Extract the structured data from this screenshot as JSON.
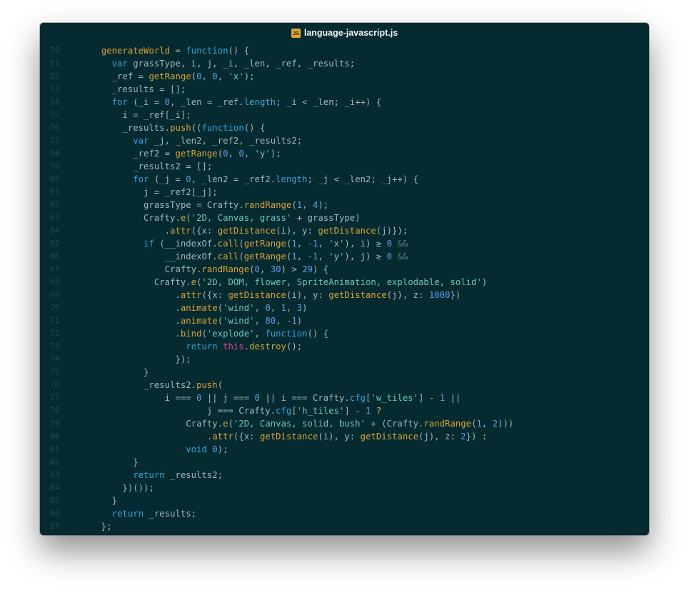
{
  "window": {
    "title": "language-javascript.js",
    "file_icon_label": "JS"
  },
  "editor": {
    "lines": [
      {
        "n": "50",
        "tokens": [
          [
            "pl",
            "  "
          ],
          [
            "def",
            "generateWorld"
          ],
          [
            "pl",
            " = "
          ],
          [
            "kw",
            "function"
          ],
          [
            "pl",
            "() {"
          ]
        ]
      },
      {
        "n": "51",
        "tokens": [
          [
            "pl",
            "    "
          ],
          [
            "kw",
            "var"
          ],
          [
            "pl",
            " grassType, i, j, _i, _len, _ref, _results;"
          ]
        ]
      },
      {
        "n": "52",
        "tokens": [
          [
            "pl",
            "    _ref = "
          ],
          [
            "fn",
            "getRange"
          ],
          [
            "pl",
            "("
          ],
          [
            "num",
            "0"
          ],
          [
            "pl",
            ", "
          ],
          [
            "num",
            "0"
          ],
          [
            "pl",
            ", "
          ],
          [
            "str",
            "'x'"
          ],
          [
            "pl",
            ");"
          ]
        ]
      },
      {
        "n": "53",
        "tokens": [
          [
            "pl",
            "    _results = [];"
          ]
        ]
      },
      {
        "n": "54",
        "tokens": [
          [
            "pl",
            "    "
          ],
          [
            "kw",
            "for"
          ],
          [
            "pl",
            " (_i = "
          ],
          [
            "num",
            "0"
          ],
          [
            "pl",
            ", _len = _ref."
          ],
          [
            "prop",
            "length"
          ],
          [
            "pl",
            "; _i < _len; _i++) {"
          ]
        ]
      },
      {
        "n": "55",
        "tokens": [
          [
            "pl",
            "      i = _ref[_i];"
          ]
        ]
      },
      {
        "n": "56",
        "tokens": [
          [
            "pl",
            "      _results."
          ],
          [
            "fn",
            "push"
          ],
          [
            "pl",
            "(("
          ],
          [
            "kw",
            "function"
          ],
          [
            "pl",
            "() {"
          ]
        ]
      },
      {
        "n": "57",
        "tokens": [
          [
            "pl",
            "        "
          ],
          [
            "kw",
            "var"
          ],
          [
            "pl",
            " _j, _len2, _ref2, _results2;"
          ]
        ]
      },
      {
        "n": "58",
        "tokens": [
          [
            "pl",
            "        _ref2 = "
          ],
          [
            "fn",
            "getRange"
          ],
          [
            "pl",
            "("
          ],
          [
            "num",
            "0"
          ],
          [
            "pl",
            ", "
          ],
          [
            "num",
            "0"
          ],
          [
            "pl",
            ", "
          ],
          [
            "str",
            "'y'"
          ],
          [
            "pl",
            ");"
          ]
        ]
      },
      {
        "n": "59",
        "tokens": [
          [
            "pl",
            "        _results2 = [];"
          ]
        ]
      },
      {
        "n": "60",
        "tokens": [
          [
            "pl",
            "        "
          ],
          [
            "kw",
            "for"
          ],
          [
            "pl",
            " (_j = "
          ],
          [
            "num",
            "0"
          ],
          [
            "pl",
            ", _len2 = _ref2."
          ],
          [
            "prop",
            "length"
          ],
          [
            "pl",
            "; _j < _len2; _j++) {"
          ]
        ]
      },
      {
        "n": "61",
        "tokens": [
          [
            "pl",
            "          j = _ref2[_j];"
          ]
        ]
      },
      {
        "n": "62",
        "tokens": [
          [
            "pl",
            "          grassType = Crafty."
          ],
          [
            "fn",
            "randRange"
          ],
          [
            "pl",
            "("
          ],
          [
            "num",
            "1"
          ],
          [
            "pl",
            ", "
          ],
          [
            "num",
            "4"
          ],
          [
            "pl",
            ");"
          ]
        ]
      },
      {
        "n": "63",
        "tokens": [
          [
            "pl",
            "          Crafty."
          ],
          [
            "fn",
            "e"
          ],
          [
            "pl",
            "("
          ],
          [
            "str",
            "'2D, Canvas, grass'"
          ],
          [
            "pl",
            " + grassType)"
          ]
        ]
      },
      {
        "n": "64",
        "tokens": [
          [
            "pl",
            "              ."
          ],
          [
            "fn",
            "attr"
          ],
          [
            "pl",
            "({x: "
          ],
          [
            "fn",
            "getDistance"
          ],
          [
            "pl",
            "(i), y: "
          ],
          [
            "fn",
            "getDistance"
          ],
          [
            "pl",
            "(j)});"
          ]
        ]
      },
      {
        "n": "65",
        "tokens": [
          [
            "pl",
            "          "
          ],
          [
            "kw",
            "if"
          ],
          [
            "pl",
            " (__indexOf."
          ],
          [
            "fn",
            "call"
          ],
          [
            "pl",
            "("
          ],
          [
            "fn",
            "getRange"
          ],
          [
            "pl",
            "("
          ],
          [
            "num",
            "1"
          ],
          [
            "pl",
            ", "
          ],
          [
            "num",
            "-1"
          ],
          [
            "pl",
            ", "
          ],
          [
            "str",
            "'x'"
          ],
          [
            "pl",
            "), i) ≥ "
          ],
          [
            "num",
            "0"
          ],
          [
            "pl",
            " "
          ],
          [
            "dim",
            "&&"
          ]
        ]
      },
      {
        "n": "66",
        "tokens": [
          [
            "pl",
            "              __indexOf."
          ],
          [
            "fn",
            "call"
          ],
          [
            "pl",
            "("
          ],
          [
            "fn",
            "getRange"
          ],
          [
            "pl",
            "("
          ],
          [
            "num",
            "1"
          ],
          [
            "pl",
            ", "
          ],
          [
            "num",
            "-1"
          ],
          [
            "pl",
            ", "
          ],
          [
            "str",
            "'y'"
          ],
          [
            "pl",
            "), j) ≥ "
          ],
          [
            "num",
            "0"
          ],
          [
            "pl",
            " "
          ],
          [
            "dim",
            "&&"
          ]
        ]
      },
      {
        "n": "67",
        "tokens": [
          [
            "pl",
            "              Crafty."
          ],
          [
            "fn",
            "randRange"
          ],
          [
            "pl",
            "("
          ],
          [
            "num",
            "0"
          ],
          [
            "pl",
            ", "
          ],
          [
            "num",
            "30"
          ],
          [
            "pl",
            ") > "
          ],
          [
            "num",
            "29"
          ],
          [
            "pl",
            ") {"
          ]
        ]
      },
      {
        "n": "68",
        "tokens": [
          [
            "pl",
            "            Crafty."
          ],
          [
            "fn",
            "e"
          ],
          [
            "pl",
            "("
          ],
          [
            "str",
            "'2D, DOM, flower, SpriteAnimation, explodable, solid'"
          ],
          [
            "pl",
            ")"
          ]
        ]
      },
      {
        "n": "69",
        "tokens": [
          [
            "pl",
            "                ."
          ],
          [
            "fn",
            "attr"
          ],
          [
            "pl",
            "({x: "
          ],
          [
            "fn",
            "getDistance"
          ],
          [
            "pl",
            "(i), y: "
          ],
          [
            "fn",
            "getDistance"
          ],
          [
            "pl",
            "(j), z: "
          ],
          [
            "num",
            "1000"
          ],
          [
            "pl",
            "})"
          ]
        ]
      },
      {
        "n": "70",
        "tokens": [
          [
            "pl",
            "                ."
          ],
          [
            "fn",
            "animate"
          ],
          [
            "pl",
            "("
          ],
          [
            "str",
            "'wind'"
          ],
          [
            "pl",
            ", "
          ],
          [
            "num",
            "0"
          ],
          [
            "pl",
            ", "
          ],
          [
            "num",
            "1"
          ],
          [
            "pl",
            ", "
          ],
          [
            "num",
            "3"
          ],
          [
            "pl",
            ")"
          ]
        ]
      },
      {
        "n": "71",
        "tokens": [
          [
            "pl",
            "                ."
          ],
          [
            "fn",
            "animate"
          ],
          [
            "pl",
            "("
          ],
          [
            "str",
            "'wind'"
          ],
          [
            "pl",
            ", "
          ],
          [
            "num",
            "80"
          ],
          [
            "pl",
            ", "
          ],
          [
            "num",
            "-1"
          ],
          [
            "pl",
            ")"
          ]
        ]
      },
      {
        "n": "72",
        "tokens": [
          [
            "pl",
            "                ."
          ],
          [
            "fn",
            "bind"
          ],
          [
            "pl",
            "("
          ],
          [
            "str",
            "'explode'"
          ],
          [
            "pl",
            ", "
          ],
          [
            "kw",
            "function"
          ],
          [
            "pl",
            "() {"
          ]
        ]
      },
      {
        "n": "73",
        "tokens": [
          [
            "pl",
            "                  "
          ],
          [
            "kw",
            "return"
          ],
          [
            "pl",
            " "
          ],
          [
            "this",
            "this"
          ],
          [
            "pl",
            "."
          ],
          [
            "fn",
            "destroy"
          ],
          [
            "pl",
            "();"
          ]
        ]
      },
      {
        "n": "74",
        "tokens": [
          [
            "pl",
            "                });"
          ]
        ]
      },
      {
        "n": "75",
        "tokens": [
          [
            "pl",
            "          }"
          ]
        ]
      },
      {
        "n": "76",
        "tokens": [
          [
            "pl",
            "          _results2."
          ],
          [
            "fn",
            "push"
          ],
          [
            "pl",
            "("
          ]
        ]
      },
      {
        "n": "77",
        "tokens": [
          [
            "pl",
            "              i === "
          ],
          [
            "num",
            "0"
          ],
          [
            "pl",
            " || j === "
          ],
          [
            "num",
            "0"
          ],
          [
            "pl",
            " || i === Crafty."
          ],
          [
            "prop",
            "cfg"
          ],
          [
            "pl",
            "["
          ],
          [
            "str",
            "'w_tiles'"
          ],
          [
            "pl",
            "] - "
          ],
          [
            "num",
            "1"
          ],
          [
            "pl",
            " ||"
          ]
        ]
      },
      {
        "n": "78",
        "tokens": [
          [
            "pl",
            "                      j === Crafty."
          ],
          [
            "prop",
            "cfg"
          ],
          [
            "pl",
            "["
          ],
          [
            "str",
            "'h_tiles'"
          ],
          [
            "pl",
            "] - "
          ],
          [
            "num",
            "1"
          ],
          [
            "pl",
            " "
          ],
          [
            "yel",
            "?"
          ]
        ]
      },
      {
        "n": "79",
        "tokens": [
          [
            "pl",
            "                  Crafty."
          ],
          [
            "fn",
            "e"
          ],
          [
            "pl",
            "("
          ],
          [
            "str",
            "'2D, Canvas, solid, bush'"
          ],
          [
            "pl",
            " + (Crafty."
          ],
          [
            "fn",
            "randRange"
          ],
          [
            "pl",
            "("
          ],
          [
            "num",
            "1"
          ],
          [
            "pl",
            ", "
          ],
          [
            "num",
            "2"
          ],
          [
            "pl",
            ")))"
          ]
        ]
      },
      {
        "n": "80",
        "tokens": [
          [
            "pl",
            "                      ."
          ],
          [
            "fn",
            "attr"
          ],
          [
            "pl",
            "({x: "
          ],
          [
            "fn",
            "getDistance"
          ],
          [
            "pl",
            "(i), y: "
          ],
          [
            "fn",
            "getDistance"
          ],
          [
            "pl",
            "(j), z: "
          ],
          [
            "num",
            "2"
          ],
          [
            "pl",
            "}) "
          ],
          [
            "yel",
            ":"
          ]
        ]
      },
      {
        "n": "81",
        "tokens": [
          [
            "pl",
            "                  "
          ],
          [
            "kw",
            "void"
          ],
          [
            "pl",
            " "
          ],
          [
            "num",
            "0"
          ],
          [
            "pl",
            ");"
          ]
        ]
      },
      {
        "n": "82",
        "tokens": [
          [
            "pl",
            "        }"
          ]
        ]
      },
      {
        "n": "83",
        "tokens": [
          [
            "pl",
            "        "
          ],
          [
            "kw",
            "return"
          ],
          [
            "pl",
            " _results2;"
          ]
        ]
      },
      {
        "n": "84",
        "tokens": [
          [
            "pl",
            "      })());"
          ]
        ]
      },
      {
        "n": "85",
        "tokens": [
          [
            "pl",
            "    }"
          ]
        ]
      },
      {
        "n": "86",
        "tokens": [
          [
            "pl",
            "    "
          ],
          [
            "kw",
            "return"
          ],
          [
            "pl",
            " _results;"
          ]
        ]
      },
      {
        "n": "87",
        "tokens": [
          [
            "pl",
            "  };"
          ]
        ]
      }
    ]
  }
}
